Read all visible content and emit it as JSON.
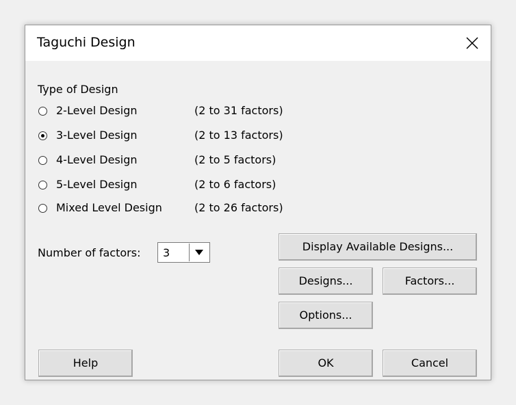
{
  "dialog": {
    "title": "Taguchi Design",
    "close_glyph": "close-icon"
  },
  "design_type": {
    "label": "Type of Design",
    "selected": "3-Level Design",
    "options": [
      {
        "label": "2-Level Design",
        "range": "(2 to 31 factors)",
        "selected": false
      },
      {
        "label": "3-Level Design",
        "range": "(2 to 13 factors)",
        "selected": true
      },
      {
        "label": "4-Level Design",
        "range": "(2 to 5 factors)",
        "selected": false
      },
      {
        "label": "5-Level Design",
        "range": "(2 to 6 factors)",
        "selected": false
      },
      {
        "label": "Mixed Level Design",
        "range": "(2 to 26 factors)",
        "selected": false
      }
    ]
  },
  "factors": {
    "label": "Number of factors:",
    "value": "3"
  },
  "buttons": {
    "display_available": "Display Available Designs...",
    "designs": "Designs...",
    "factors": "Factors...",
    "options": "Options...",
    "help": "Help",
    "ok": "OK",
    "cancel": "Cancel"
  }
}
